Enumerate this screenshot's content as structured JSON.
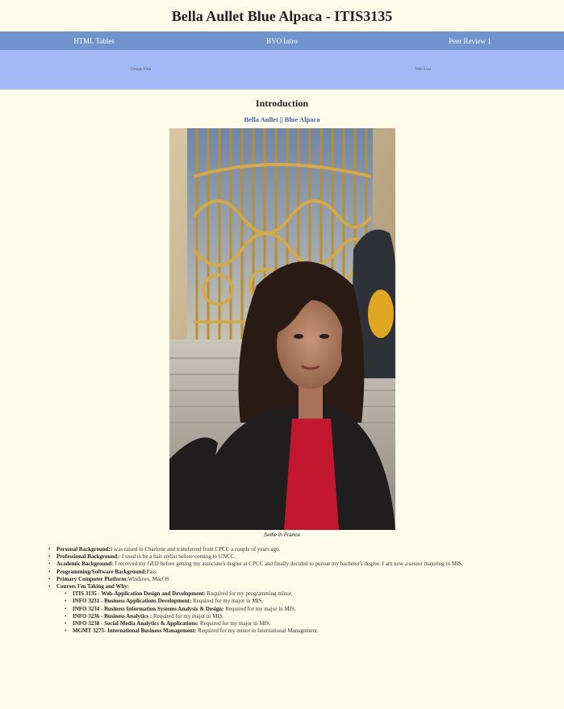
{
  "site_title": "Bella Aullet Blue Alpaca - ITIS3135",
  "nav_primary": [
    {
      "label": "HTML Tables"
    },
    {
      "label": "BYO Intro"
    },
    {
      "label": "Peer Review 1"
    }
  ],
  "nav_secondary": [
    {
      "label": "Design Firm"
    },
    {
      "label": "Web Eval"
    }
  ],
  "intro": {
    "heading": "Introduction",
    "byline": "Bella Aullet || Blue Alpaca",
    "caption": "Selfie in France"
  },
  "bio": [
    {
      "label": "Personal Background:",
      "text": "I was raised in Charlotte and transferred from CPCC a couple of years ago."
    },
    {
      "label": "Professional Background:",
      "text": ": I used to be a hair stylist before coming to UNCC."
    },
    {
      "label": "Academic Background:",
      "text": " I received my GED before getting my associate's degree at CPCC and finally decided to pursue my bachelor's degree. I am now a senior majoring in MIS."
    },
    {
      "label": "Programming/Software Background:",
      "text": "Pass"
    },
    {
      "label": "Primary Computer Platform:",
      "text": "Windows, MacOS"
    },
    {
      "label": "Courses I'm Taking and Why:",
      "text": ""
    }
  ],
  "courses": [
    {
      "label": "ITIS 3135 - Web-Application Design and Development:",
      "text": " Required for my programming minor."
    },
    {
      "label": "INFO 3231 - Business Applications Development:",
      "text": " Required for my major in MIS."
    },
    {
      "label": "INFO 3234 - Business Information Systems Analysis & Design:",
      "text": " Required for my major in MIS."
    },
    {
      "label": "INFO 3236 - Business Analytics :",
      "text": " Required for my major in MIS."
    },
    {
      "label": "INFO 3238 - Social Media Analytics & Applications:",
      "text": " Required for my major in MIS."
    },
    {
      "label": "MGMT 3275- International Business Management:",
      "text": " Required for my minor in International Management."
    }
  ]
}
